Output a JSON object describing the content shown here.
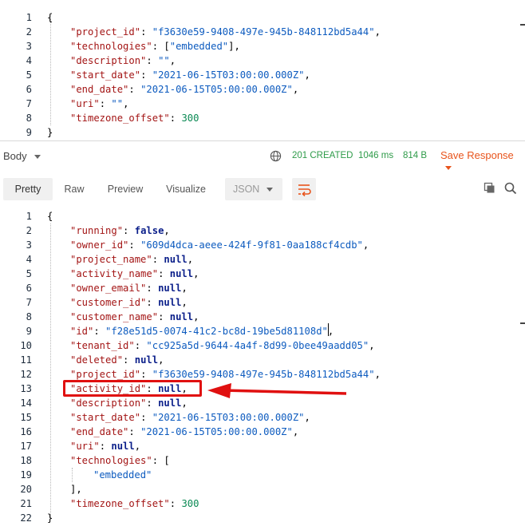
{
  "request_body": {
    "lines": [
      {
        "n": "1",
        "indent": 0,
        "tokens": [
          {
            "t": "{",
            "c": "p"
          }
        ]
      },
      {
        "n": "2",
        "indent": 1,
        "tokens": [
          {
            "t": "\"project_id\"",
            "c": "k"
          },
          {
            "t": ": ",
            "c": "p"
          },
          {
            "t": "\"f3630e59-9408-497e-945b-848112bd5a44\"",
            "c": "s"
          },
          {
            "t": ",",
            "c": "p"
          }
        ]
      },
      {
        "n": "3",
        "indent": 1,
        "tokens": [
          {
            "t": "\"technologies\"",
            "c": "k"
          },
          {
            "t": ": [",
            "c": "p"
          },
          {
            "t": "\"embedded\"",
            "c": "s"
          },
          {
            "t": "],",
            "c": "p"
          }
        ]
      },
      {
        "n": "4",
        "indent": 1,
        "tokens": [
          {
            "t": "\"description\"",
            "c": "k"
          },
          {
            "t": ": ",
            "c": "p"
          },
          {
            "t": "\"\"",
            "c": "s"
          },
          {
            "t": ",",
            "c": "p"
          }
        ]
      },
      {
        "n": "5",
        "indent": 1,
        "tokens": [
          {
            "t": "\"start_date\"",
            "c": "k"
          },
          {
            "t": ": ",
            "c": "p"
          },
          {
            "t": "\"2021-06-15T03:00:00.000Z\"",
            "c": "s"
          },
          {
            "t": ",",
            "c": "p"
          }
        ]
      },
      {
        "n": "6",
        "indent": 1,
        "tokens": [
          {
            "t": "\"end_date\"",
            "c": "k"
          },
          {
            "t": ": ",
            "c": "p"
          },
          {
            "t": "\"2021-06-15T05:00:00.000Z\"",
            "c": "s"
          },
          {
            "t": ",",
            "c": "p"
          }
        ]
      },
      {
        "n": "7",
        "indent": 1,
        "tokens": [
          {
            "t": "\"uri\"",
            "c": "k"
          },
          {
            "t": ": ",
            "c": "p"
          },
          {
            "t": "\"\"",
            "c": "s"
          },
          {
            "t": ",",
            "c": "p"
          }
        ]
      },
      {
        "n": "8",
        "indent": 1,
        "tokens": [
          {
            "t": "\"timezone_offset\"",
            "c": "k"
          },
          {
            "t": ": ",
            "c": "p"
          },
          {
            "t": "300",
            "c": "n"
          }
        ]
      },
      {
        "n": "9",
        "indent": 0,
        "tokens": [
          {
            "t": "}",
            "c": "p"
          }
        ]
      }
    ]
  },
  "response_header": {
    "body_label": "Body",
    "status": "201 CREATED",
    "time": "1046 ms",
    "size": "814 B",
    "save_response": "Save Response"
  },
  "response_tabs": {
    "items": [
      "Pretty",
      "Raw",
      "Preview",
      "Visualize"
    ],
    "active": "Pretty",
    "format": "JSON"
  },
  "response_body": {
    "lines": [
      {
        "n": "1",
        "indent": 0,
        "tokens": [
          {
            "t": "{",
            "c": "p"
          }
        ]
      },
      {
        "n": "2",
        "indent": 1,
        "tokens": [
          {
            "t": "\"running\"",
            "c": "k"
          },
          {
            "t": ": ",
            "c": "p"
          },
          {
            "t": "false",
            "c": "b"
          },
          {
            "t": ",",
            "c": "p"
          }
        ]
      },
      {
        "n": "3",
        "indent": 1,
        "tokens": [
          {
            "t": "\"owner_id\"",
            "c": "k"
          },
          {
            "t": ": ",
            "c": "p"
          },
          {
            "t": "\"609d4dca-aeee-424f-9f81-0aa188cf4cdb\"",
            "c": "s"
          },
          {
            "t": ",",
            "c": "p"
          }
        ]
      },
      {
        "n": "4",
        "indent": 1,
        "tokens": [
          {
            "t": "\"project_name\"",
            "c": "k"
          },
          {
            "t": ": ",
            "c": "p"
          },
          {
            "t": "null",
            "c": "b"
          },
          {
            "t": ",",
            "c": "p"
          }
        ]
      },
      {
        "n": "5",
        "indent": 1,
        "tokens": [
          {
            "t": "\"activity_name\"",
            "c": "k"
          },
          {
            "t": ": ",
            "c": "p"
          },
          {
            "t": "null",
            "c": "b"
          },
          {
            "t": ",",
            "c": "p"
          }
        ]
      },
      {
        "n": "6",
        "indent": 1,
        "tokens": [
          {
            "t": "\"owner_email\"",
            "c": "k"
          },
          {
            "t": ": ",
            "c": "p"
          },
          {
            "t": "null",
            "c": "b"
          },
          {
            "t": ",",
            "c": "p"
          }
        ]
      },
      {
        "n": "7",
        "indent": 1,
        "tokens": [
          {
            "t": "\"customer_id\"",
            "c": "k"
          },
          {
            "t": ": ",
            "c": "p"
          },
          {
            "t": "null",
            "c": "b"
          },
          {
            "t": ",",
            "c": "p"
          }
        ]
      },
      {
        "n": "8",
        "indent": 1,
        "tokens": [
          {
            "t": "\"customer_name\"",
            "c": "k"
          },
          {
            "t": ": ",
            "c": "p"
          },
          {
            "t": "null",
            "c": "b"
          },
          {
            "t": ",",
            "c": "p"
          }
        ]
      },
      {
        "n": "9",
        "indent": 1,
        "tokens": [
          {
            "t": "\"id\"",
            "c": "k"
          },
          {
            "t": ": ",
            "c": "p"
          },
          {
            "t": "\"f28e51d5-0074-41c2-bc8d-19be5d81108d\"",
            "c": "s"
          },
          {
            "t": ",",
            "c": "p"
          }
        ]
      },
      {
        "n": "10",
        "indent": 1,
        "tokens": [
          {
            "t": "\"tenant_id\"",
            "c": "k"
          },
          {
            "t": ": ",
            "c": "p"
          },
          {
            "t": "\"cc925a5d-9644-4a4f-8d99-0bee49aadd05\"",
            "c": "s"
          },
          {
            "t": ",",
            "c": "p"
          }
        ]
      },
      {
        "n": "11",
        "indent": 1,
        "tokens": [
          {
            "t": "\"deleted\"",
            "c": "k"
          },
          {
            "t": ": ",
            "c": "p"
          },
          {
            "t": "null",
            "c": "b"
          },
          {
            "t": ",",
            "c": "p"
          }
        ]
      },
      {
        "n": "12",
        "indent": 1,
        "tokens": [
          {
            "t": "\"project_id\"",
            "c": "k"
          },
          {
            "t": ": ",
            "c": "p"
          },
          {
            "t": "\"f3630e59-9408-497e-945b-848112bd5a44\"",
            "c": "s"
          },
          {
            "t": ",",
            "c": "p"
          }
        ]
      },
      {
        "n": "13",
        "indent": 1,
        "tokens": [
          {
            "t": "\"activity_id\"",
            "c": "k"
          },
          {
            "t": ": ",
            "c": "p"
          },
          {
            "t": "null",
            "c": "b"
          },
          {
            "t": ",",
            "c": "p"
          }
        ]
      },
      {
        "n": "14",
        "indent": 1,
        "tokens": [
          {
            "t": "\"description\"",
            "c": "k"
          },
          {
            "t": ": ",
            "c": "p"
          },
          {
            "t": "null",
            "c": "b"
          },
          {
            "t": ",",
            "c": "p"
          }
        ]
      },
      {
        "n": "15",
        "indent": 1,
        "tokens": [
          {
            "t": "\"start_date\"",
            "c": "k"
          },
          {
            "t": ": ",
            "c": "p"
          },
          {
            "t": "\"2021-06-15T03:00:00.000Z\"",
            "c": "s"
          },
          {
            "t": ",",
            "c": "p"
          }
        ]
      },
      {
        "n": "16",
        "indent": 1,
        "tokens": [
          {
            "t": "\"end_date\"",
            "c": "k"
          },
          {
            "t": ": ",
            "c": "p"
          },
          {
            "t": "\"2021-06-15T05:00:00.000Z\"",
            "c": "s"
          },
          {
            "t": ",",
            "c": "p"
          }
        ]
      },
      {
        "n": "17",
        "indent": 1,
        "tokens": [
          {
            "t": "\"uri\"",
            "c": "k"
          },
          {
            "t": ": ",
            "c": "p"
          },
          {
            "t": "null",
            "c": "b"
          },
          {
            "t": ",",
            "c": "p"
          }
        ]
      },
      {
        "n": "18",
        "indent": 1,
        "tokens": [
          {
            "t": "\"technologies\"",
            "c": "k"
          },
          {
            "t": ": [",
            "c": "p"
          }
        ]
      },
      {
        "n": "19",
        "indent": 2,
        "tokens": [
          {
            "t": "\"embedded\"",
            "c": "s"
          }
        ]
      },
      {
        "n": "20",
        "indent": 1,
        "tokens": [
          {
            "t": "],",
            "c": "p"
          }
        ]
      },
      {
        "n": "21",
        "indent": 1,
        "tokens": [
          {
            "t": "\"timezone_offset\"",
            "c": "k"
          },
          {
            "t": ": ",
            "c": "p"
          },
          {
            "t": "300",
            "c": "n"
          }
        ]
      },
      {
        "n": "22",
        "indent": 0,
        "tokens": [
          {
            "t": "}",
            "c": "p"
          }
        ]
      }
    ]
  },
  "colors": {
    "key": "#a31515",
    "string": "#0d5bbf",
    "number": "#0b8a54",
    "keyword": "#0b1f8a",
    "status_ok": "#2e9b49",
    "accent": "#e8541c",
    "annotation": "#e01010"
  }
}
